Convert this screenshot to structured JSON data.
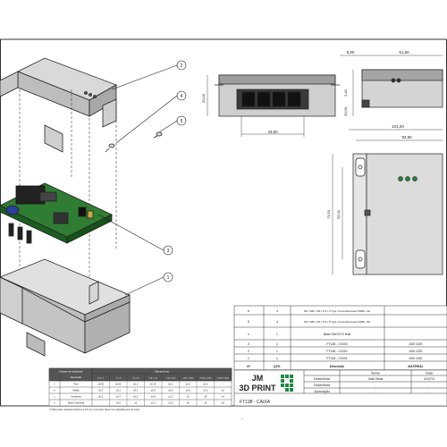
{
  "callouts": [
    "2",
    "4",
    "5",
    "3",
    "1"
  ],
  "dimensions": {
    "top_width": "51,60",
    "top_small": "5,80",
    "front_width": "43,50",
    "side_small": "2,40",
    "side_height": "20,00",
    "overall_width": "101,00",
    "inner_width": "93,50",
    "height_left": "55,00",
    "height_left2": "73,50"
  },
  "bom": {
    "rows": [
      {
        "item": "6",
        "qty": "4",
        "desc": "ISO 7380 - M3 x 0,5 x 4 Type I Cross Recessed PHMS --4H",
        "material": ""
      },
      {
        "item": "5",
        "qty": "4",
        "desc": "ISO 7380 - M3 x 0,5 x 8 Type I Cross Recessed PHMS --8H",
        "material": ""
      },
      {
        "item": "4",
        "qty": "1",
        "desc": "Base RAK3172 final",
        "material": ""
      },
      {
        "item": "3",
        "qty": "1",
        "desc": "FT138 - CX003",
        "material": "AISI 1020"
      },
      {
        "item": "2",
        "qty": "1",
        "desc": "FT138 - CX002",
        "material": "AISI 1020"
      },
      {
        "item": "1",
        "qty": "1",
        "desc": "FT138 - CX001",
        "material": "AISI 1020"
      }
    ],
    "header": {
      "item": "Nº",
      "qty": "QTD.",
      "desc": "Descrição",
      "material": "MATERIAL"
    }
  },
  "title_block": {
    "logo_line1": "JM",
    "logo_line2": "3D PRINT",
    "col_name": "Nome",
    "col_date": "Data",
    "row1_label": "Desenhista",
    "row1_name": "João Mota",
    "row1_date": "31/07/2",
    "row2_label": "Desenhista",
    "row2_name": "-",
    "row2_date": "-",
    "row3_label": "Aprovação",
    "row3_name": "-",
    "row3_date": "-",
    "drawing_title": "FT138 - CAIXA",
    "dash": "-"
  },
  "tolerance_table": {
    "title": "Classes de tolerância",
    "subheader": "Descrição",
    "group_header": "Gamas (mm)",
    "cols": [
      "0,5 a 3",
      ">3 a 6",
      ">6 a 30",
      ">30 a 120",
      ">120 a 400",
      ">400 a 1000",
      ">1000 a 2000",
      ">2000 a 4000"
    ],
    "rows": [
      {
        "cls": "f",
        "desc": "Fina",
        "vals": [
          "±0,05",
          "±0,05",
          "±0,1",
          "±0,15",
          "±0,2",
          "±0,3",
          "±0,5",
          "-"
        ]
      },
      {
        "cls": "m",
        "desc": "Média",
        "vals": [
          "±0,1",
          "±0,1",
          "±0,2",
          "±0,3",
          "±0,5",
          "±0,8",
          "±1,2",
          "±2"
        ]
      },
      {
        "cls": "c",
        "desc": "Grosseira",
        "vals": [
          "±0,2",
          "±0,3",
          "±0,5",
          "±0,8",
          "±1,2",
          "±2",
          "±3",
          "±4"
        ]
      },
      {
        "cls": "v",
        "desc": "Muito Grosseira",
        "vals": [
          "-",
          "±0,5",
          "±1",
          "±1,5",
          "±2,5",
          "±4",
          "±6",
          "±8"
        ]
      }
    ],
    "note": "(*) Para cotas nominais inferiores a 0,5 mm, os desvios devem ser indicados junto às cotas"
  }
}
